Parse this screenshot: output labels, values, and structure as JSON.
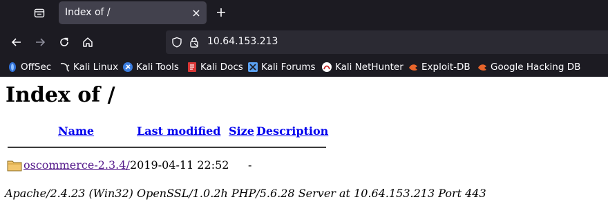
{
  "browser": {
    "tab": {
      "title": "Index of /"
    },
    "url": "10.64.153.213",
    "bookmarks": [
      {
        "label": "OffSec",
        "icon": "offsec-icon"
      },
      {
        "label": "Kali Linux",
        "icon": "kali-dragon-icon"
      },
      {
        "label": "Kali Tools",
        "icon": "kali-tools-icon"
      },
      {
        "label": "Kali Docs",
        "icon": "kali-docs-icon"
      },
      {
        "label": "Kali Forums",
        "icon": "kali-forums-icon"
      },
      {
        "label": "Kali NetHunter",
        "icon": "nethunter-icon"
      },
      {
        "label": "Exploit-DB",
        "icon": "exploit-db-icon"
      },
      {
        "label": "Google Hacking DB",
        "icon": "ghdb-icon"
      }
    ]
  },
  "page": {
    "heading": "Index of /",
    "columns": {
      "name": "Name",
      "last_modified": "Last modified",
      "size": "Size",
      "description": "Description"
    },
    "entries": [
      {
        "name": "oscommerce-2.3.4/",
        "last_modified": "2019-04-11 22:52",
        "size": "-",
        "description": "",
        "icon": "folder-icon"
      }
    ],
    "address": "Apache/2.4.23 (Win32) OpenSSL/1.0.2h PHP/5.6.28 Server at 10.64.153.213 Port 443"
  },
  "colors": {
    "chrome_bg": "#1c1b22",
    "tab_bg": "#42414d",
    "urlbar_bg": "#2b2a33",
    "link": "#0000ee",
    "visited_link": "#551a8b"
  }
}
